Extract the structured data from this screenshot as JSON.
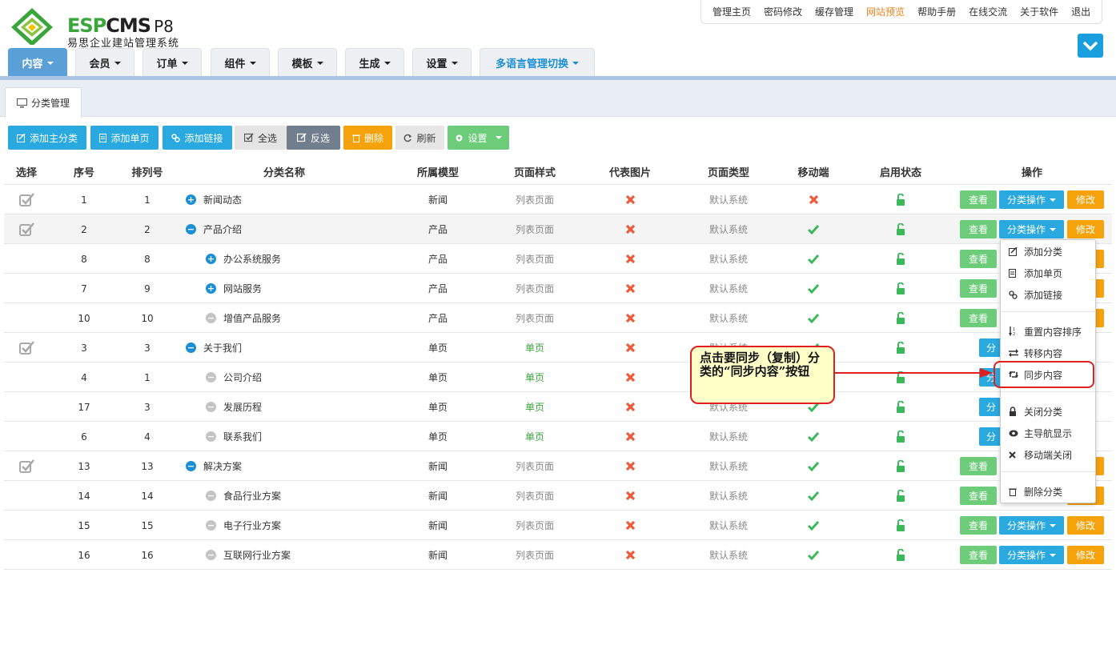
{
  "app": {
    "logo_brand": "ESPCMS",
    "logo_version": "P8",
    "logo_subtitle": "易思企业建站管理系统"
  },
  "top_menu": {
    "items": [
      {
        "label": "管理主页"
      },
      {
        "label": "密码修改"
      },
      {
        "label": "缓存管理"
      },
      {
        "label": "网站预览",
        "highlight": "#f0831d"
      },
      {
        "label": "帮助手册"
      },
      {
        "label": "在线交流"
      },
      {
        "label": "关于软件"
      },
      {
        "label": "退出"
      }
    ]
  },
  "nav": {
    "tabs": [
      {
        "label": "内容",
        "active": true
      },
      {
        "label": "会员"
      },
      {
        "label": "订单"
      },
      {
        "label": "组件"
      },
      {
        "label": "模板"
      },
      {
        "label": "生成"
      },
      {
        "label": "设置"
      },
      {
        "label": "多语言管理切换",
        "color": "#1a8fd6"
      }
    ]
  },
  "subtab": {
    "label": "分类管理",
    "icon": "monitor-icon"
  },
  "toolbar": {
    "add_main": "添加主分类",
    "add_page": "添加单页",
    "add_link": "添加链接",
    "select_all": "全选",
    "invert": "反选",
    "delete": "删除",
    "refresh": "刷新",
    "settings": "设置"
  },
  "table": {
    "headers": [
      "选择",
      "序号",
      "排列号",
      "分类名称",
      "所属模型",
      "页面样式",
      "代表图片",
      "页面类型",
      "移动端",
      "启用状态",
      "操作"
    ],
    "rows": [
      {
        "checkbox": true,
        "id": "1",
        "order": "1",
        "name": "新闻动态",
        "level": 0,
        "toggle": "plus",
        "model": "新闻",
        "style": "列表页面",
        "style_green": false,
        "image": "no",
        "type": "默认系统",
        "mobile": "no",
        "status": "unlocked"
      },
      {
        "checkbox": true,
        "id": "2",
        "order": "2",
        "name": "产品介绍",
        "level": 0,
        "toggle": "minus",
        "model": "产品",
        "style": "列表页面",
        "style_green": false,
        "image": "no",
        "type": "默认系统",
        "mobile": "yes",
        "status": "unlocked"
      },
      {
        "checkbox": false,
        "id": "8",
        "order": "8",
        "name": "办公系统服务",
        "level": 1,
        "toggle": "plus",
        "model": "产品",
        "style": "列表页面",
        "style_green": false,
        "image": "no",
        "type": "默认系统",
        "mobile": "yes",
        "status": "unlocked"
      },
      {
        "checkbox": false,
        "id": "7",
        "order": "9",
        "name": "网站服务",
        "level": 1,
        "toggle": "plus",
        "model": "产品",
        "style": "列表页面",
        "style_green": false,
        "image": "no",
        "type": "默认系统",
        "mobile": "yes",
        "status": "unlocked"
      },
      {
        "checkbox": false,
        "id": "10",
        "order": "10",
        "name": "增值产品服务",
        "level": 1,
        "toggle": "leaf",
        "model": "产品",
        "style": "列表页面",
        "style_green": false,
        "image": "no",
        "type": "默认系统",
        "mobile": "yes",
        "status": "unlocked"
      },
      {
        "checkbox": true,
        "id": "3",
        "order": "3",
        "name": "关于我们",
        "level": 0,
        "toggle": "minus",
        "model": "单页",
        "style": "单页",
        "style_green": true,
        "image": "no",
        "type": "默认系统",
        "mobile": "yes",
        "status": "unlocked"
      },
      {
        "checkbox": false,
        "id": "4",
        "order": "1",
        "name": "公司介绍",
        "level": 1,
        "toggle": "leaf",
        "model": "单页",
        "style": "单页",
        "style_green": true,
        "image": "no",
        "type": "默认系统",
        "mobile": "yes",
        "status": "unlocked"
      },
      {
        "checkbox": false,
        "id": "17",
        "order": "3",
        "name": "发展历程",
        "level": 1,
        "toggle": "leaf",
        "model": "单页",
        "style": "单页",
        "style_green": true,
        "image": "no",
        "type": "默认系统",
        "mobile": "yes",
        "status": "unlocked"
      },
      {
        "checkbox": false,
        "id": "6",
        "order": "4",
        "name": "联系我们",
        "level": 1,
        "toggle": "leaf",
        "model": "单页",
        "style": "单页",
        "style_green": true,
        "image": "no",
        "type": "默认系统",
        "mobile": "yes",
        "status": "unlocked"
      },
      {
        "checkbox": true,
        "id": "13",
        "order": "13",
        "name": "解决方案",
        "level": 0,
        "toggle": "minus",
        "model": "新闻",
        "style": "列表页面",
        "style_green": false,
        "image": "no",
        "type": "默认系统",
        "mobile": "yes",
        "status": "unlocked"
      },
      {
        "checkbox": false,
        "id": "14",
        "order": "14",
        "name": "食品行业方案",
        "level": 1,
        "toggle": "leaf",
        "model": "新闻",
        "style": "列表页面",
        "style_green": false,
        "image": "no",
        "type": "默认系统",
        "mobile": "yes",
        "status": "unlocked"
      },
      {
        "checkbox": false,
        "id": "15",
        "order": "15",
        "name": "电子行业方案",
        "level": 1,
        "toggle": "leaf",
        "model": "新闻",
        "style": "列表页面",
        "style_green": false,
        "image": "no",
        "type": "默认系统",
        "mobile": "yes",
        "status": "unlocked"
      },
      {
        "checkbox": false,
        "id": "16",
        "order": "16",
        "name": "互联网行业方案",
        "level": 1,
        "toggle": "leaf",
        "model": "新闻",
        "style": "列表页面",
        "style_green": false,
        "image": "no",
        "type": "默认系统",
        "mobile": "yes",
        "status": "unlocked"
      }
    ],
    "action_view": "查看",
    "action_op": "分类操作",
    "action_edit": "修改",
    "action_op_short": "分"
  },
  "dropdown": {
    "items": [
      {
        "label": "添加分类",
        "icon": "edit-icon"
      },
      {
        "label": "添加单页",
        "icon": "file-icon"
      },
      {
        "label": "添加链接",
        "icon": "link-icon"
      },
      {
        "label": "重置内容排序",
        "icon": "sort-icon"
      },
      {
        "label": "转移内容",
        "icon": "exchange-icon"
      },
      {
        "label": "同步内容",
        "icon": "retweet-icon"
      },
      {
        "label": "关闭分类",
        "icon": "lock-icon"
      },
      {
        "label": "主导航显示",
        "icon": "eye-icon"
      },
      {
        "label": "移动端关闭",
        "icon": "close-icon"
      },
      {
        "label": "删除分类",
        "icon": "trash-icon"
      }
    ]
  },
  "callout": {
    "text": "点击要同步（复制）分类的“同步内容”按钮"
  },
  "colors": {
    "accent": "#29a9e0",
    "green": "#6dcc7a",
    "orange": "#f6a20b",
    "red": "#e02020"
  }
}
